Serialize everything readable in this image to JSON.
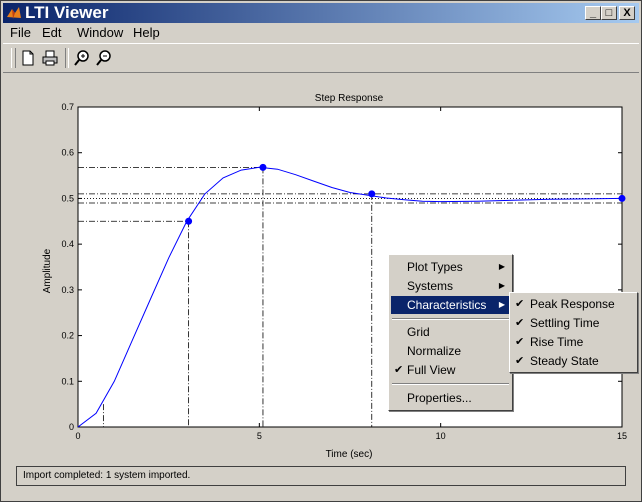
{
  "window": {
    "title": "LTI Viewer",
    "min": "_",
    "max": "□",
    "close": "X"
  },
  "menu": [
    "File",
    "Edt",
    "Window",
    "Help"
  ],
  "toolbar": {
    "icons": [
      "new-icon",
      "print-icon",
      "zoom-in-icon",
      "zoom-out-icon"
    ]
  },
  "status": {
    "text": "Import completed: 1 system imported."
  },
  "chart_data": {
    "type": "line",
    "title": "Step Response",
    "xlabel": "Time (sec)",
    "ylabel": "Amplitude",
    "xlim": [
      0,
      15
    ],
    "ylim": [
      0,
      0.7
    ],
    "xticks": [
      0,
      5,
      10,
      15
    ],
    "yticks": [
      0,
      0.1,
      0.2,
      0.3,
      0.4,
      0.5,
      0.6,
      0.7
    ],
    "series": [
      {
        "color": "#0000ff",
        "x": [
          0,
          0.5,
          1,
          1.5,
          2,
          2.5,
          3,
          3.5,
          4,
          4.5,
          5,
          5.5,
          6,
          6.5,
          7,
          7.5,
          8,
          8.5,
          9,
          9.5,
          10,
          11,
          12,
          13,
          14,
          15
        ],
        "y": [
          0,
          0.03,
          0.1,
          0.19,
          0.28,
          0.37,
          0.45,
          0.51,
          0.545,
          0.562,
          0.568,
          0.564,
          0.552,
          0.538,
          0.524,
          0.513,
          0.507,
          0.501,
          0.497,
          0.494,
          0.493,
          0.494,
          0.496,
          0.498,
          0.499,
          0.5
        ]
      }
    ],
    "characteristics": {
      "peak": {
        "x": 5.1,
        "y": 0.568
      },
      "rise": {
        "x_start": 0.7,
        "x_end": 3.05,
        "y_start": 0.05,
        "y_end": 0.45
      },
      "settling": {
        "x": 8.1,
        "y": 0.51,
        "band": [
          0.49,
          0.51
        ]
      },
      "steady_state": {
        "x": 15,
        "y": 0.5
      }
    },
    "grid": false
  },
  "context_menu": {
    "items": [
      {
        "label": "Plot Types",
        "submenu": true
      },
      {
        "label": "Systems",
        "submenu": true
      },
      {
        "label": "Characteristics",
        "submenu": true,
        "selected": true
      },
      {
        "label": "Grid"
      },
      {
        "label": "Normalize"
      },
      {
        "label": "Full View",
        "checked": true
      },
      {
        "label": "Properties..."
      }
    ],
    "submenu": [
      {
        "label": "Peak Response",
        "checked": true
      },
      {
        "label": "Settling Time",
        "checked": true
      },
      {
        "label": "Rise Time",
        "checked": true
      },
      {
        "label": "Steady State",
        "checked": true
      }
    ]
  }
}
